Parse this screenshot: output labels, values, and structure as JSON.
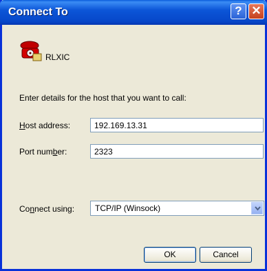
{
  "window": {
    "title": "Connect To"
  },
  "titlebar": {
    "help_glyph": "?",
    "close_glyph": "✕"
  },
  "connection": {
    "name": "RLXIC",
    "icon": "telephone-icon"
  },
  "prompt": "Enter details for the host that you want to call:",
  "host": {
    "label_pre": "",
    "label_key": "H",
    "label_post": "ost address:",
    "value": "192.169.13.31"
  },
  "port": {
    "label_pre": "Port num",
    "label_key": "b",
    "label_post": "er:",
    "value": "2323"
  },
  "connect_using": {
    "label_pre": "Co",
    "label_key": "n",
    "label_post": "nect using:",
    "value": "TCP/IP (Winsock)"
  },
  "buttons": {
    "ok": "OK",
    "cancel": "Cancel"
  }
}
